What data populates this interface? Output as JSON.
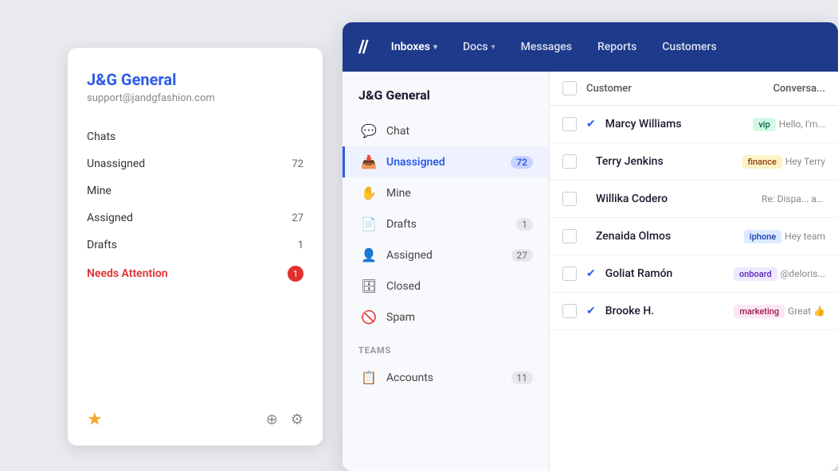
{
  "bgCard": {
    "title": "J&G General",
    "email": "support@jandgfashion.com",
    "navItems": [
      {
        "label": "Chats",
        "count": null
      },
      {
        "label": "Unassigned",
        "count": "72"
      },
      {
        "label": "Mine",
        "count": null
      },
      {
        "label": "Assigned",
        "count": "27"
      },
      {
        "label": "Drafts",
        "count": "1"
      },
      {
        "label": "Needs Attention",
        "count": "1",
        "special": "attention"
      }
    ]
  },
  "topNav": {
    "logo": "//",
    "links": [
      {
        "label": "Inboxes",
        "hasChevron": true
      },
      {
        "label": "Docs",
        "hasChevron": true
      },
      {
        "label": "Messages",
        "hasChevron": false
      },
      {
        "label": "Reports",
        "hasChevron": false
      },
      {
        "label": "Customers",
        "hasChevron": false
      }
    ]
  },
  "sidebar": {
    "title": "J&G General",
    "items": [
      {
        "id": "chat",
        "label": "Chat",
        "icon": "💬",
        "count": null,
        "active": false
      },
      {
        "id": "unassigned",
        "label": "Unassigned",
        "icon": "📥",
        "count": "72",
        "active": true
      },
      {
        "id": "mine",
        "label": "Mine",
        "icon": "✋",
        "count": null,
        "active": false
      },
      {
        "id": "drafts",
        "label": "Drafts",
        "icon": "📄",
        "count": "1",
        "active": false
      },
      {
        "id": "assigned",
        "label": "Assigned",
        "icon": "👤",
        "count": "27",
        "active": false
      },
      {
        "id": "closed",
        "label": "Closed",
        "icon": "🗄",
        "count": null,
        "active": false
      },
      {
        "id": "spam",
        "label": "Spam",
        "icon": "🚫",
        "count": null,
        "active": false
      }
    ],
    "teamsLabel": "TEAMS",
    "teams": [
      {
        "label": "Accounts",
        "count": "11"
      }
    ]
  },
  "listHeader": {
    "customerLabel": "Customer",
    "conversationLabel": "Conversa..."
  },
  "listRows": [
    {
      "name": "Marcy Williams",
      "hasCheckCircle": true,
      "tags": [
        {
          "label": "vip",
          "type": "vip"
        }
      ],
      "snippet": "Hello, I'm..."
    },
    {
      "name": "Terry Jenkins",
      "hasCheckCircle": false,
      "tags": [
        {
          "label": "finance",
          "type": "finance"
        }
      ],
      "snippet": "Hey Terry"
    },
    {
      "name": "Willika Codero",
      "hasCheckCircle": false,
      "tags": [],
      "snippet": "Re: Dispa... awesome..."
    },
    {
      "name": "Zenaida Olmos",
      "hasCheckCircle": false,
      "tags": [
        {
          "label": "iphone",
          "type": "iphone"
        }
      ],
      "snippet": "Hey team"
    },
    {
      "name": "Goliat Ramón",
      "hasCheckCircle": true,
      "tags": [
        {
          "label": "onboard",
          "type": "onboard"
        }
      ],
      "snippet": "@deloris..."
    },
    {
      "name": "Brooke H.",
      "hasCheckCircle": true,
      "tags": [
        {
          "label": "marketing",
          "type": "marketing"
        }
      ],
      "snippet": "Great 👍"
    }
  ]
}
